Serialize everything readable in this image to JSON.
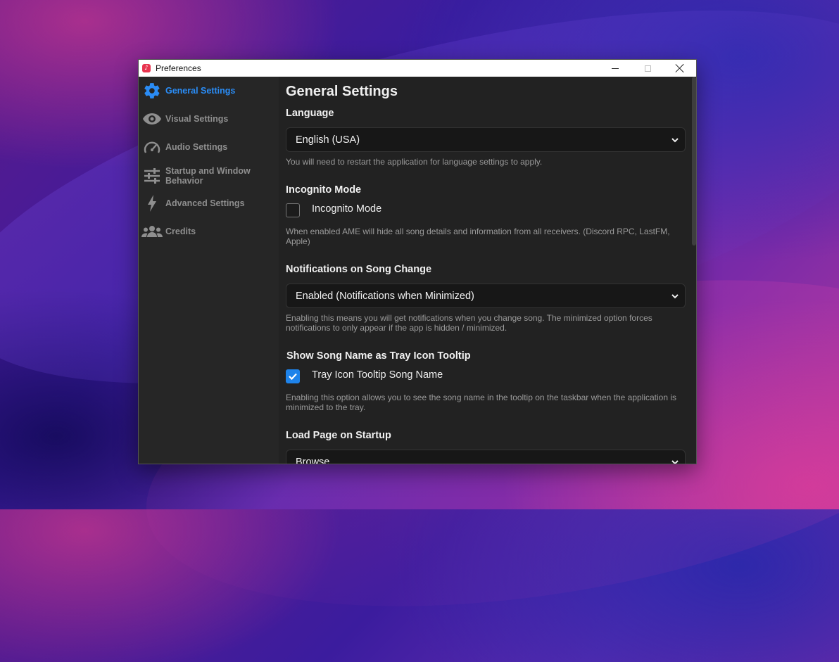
{
  "window": {
    "title": "Preferences"
  },
  "sidebar": {
    "items": [
      {
        "label": "General Settings",
        "icon": "gear-icon"
      },
      {
        "label": "Visual Settings",
        "icon": "eye-icon"
      },
      {
        "label": "Audio Settings",
        "icon": "gauge-icon"
      },
      {
        "label": "Startup and Window Behavior",
        "icon": "sliders-icon"
      },
      {
        "label": "Advanced Settings",
        "icon": "bolt-icon"
      },
      {
        "label": "Credits",
        "icon": "users-icon"
      }
    ]
  },
  "main": {
    "title": "General Settings",
    "language": {
      "heading": "Language",
      "value": "English (USA)",
      "description": "You will need to restart the application for language settings to apply."
    },
    "incognito": {
      "heading": "Incognito Mode",
      "checkbox_label": "Incognito Mode",
      "checked": false,
      "description": "When enabled AME will hide all song details and information from all receivers. (Discord RPC, LastFM, Apple)"
    },
    "notifications": {
      "heading": "Notifications on Song Change",
      "value": "Enabled (Notifications when Minimized)",
      "description": "Enabling this means you will get notifications when you change song. The minimized option forces notifications to only appear if the app is hidden / minimized."
    },
    "tray_tooltip": {
      "heading": "Show Song Name as Tray Icon Tooltip",
      "checkbox_label": "Tray Icon Tooltip Song Name",
      "checked": true,
      "description": "Enabling this option allows you to see the song name in the tooltip on the taskbar when the application is minimized to the tray."
    },
    "startup_page": {
      "heading": "Load Page on Startup",
      "value": "Browse"
    }
  },
  "colors": {
    "accent": "#2a8cf5",
    "window_bg": "#222222",
    "sidebar_bg": "#262626",
    "select_bg": "#171717"
  }
}
